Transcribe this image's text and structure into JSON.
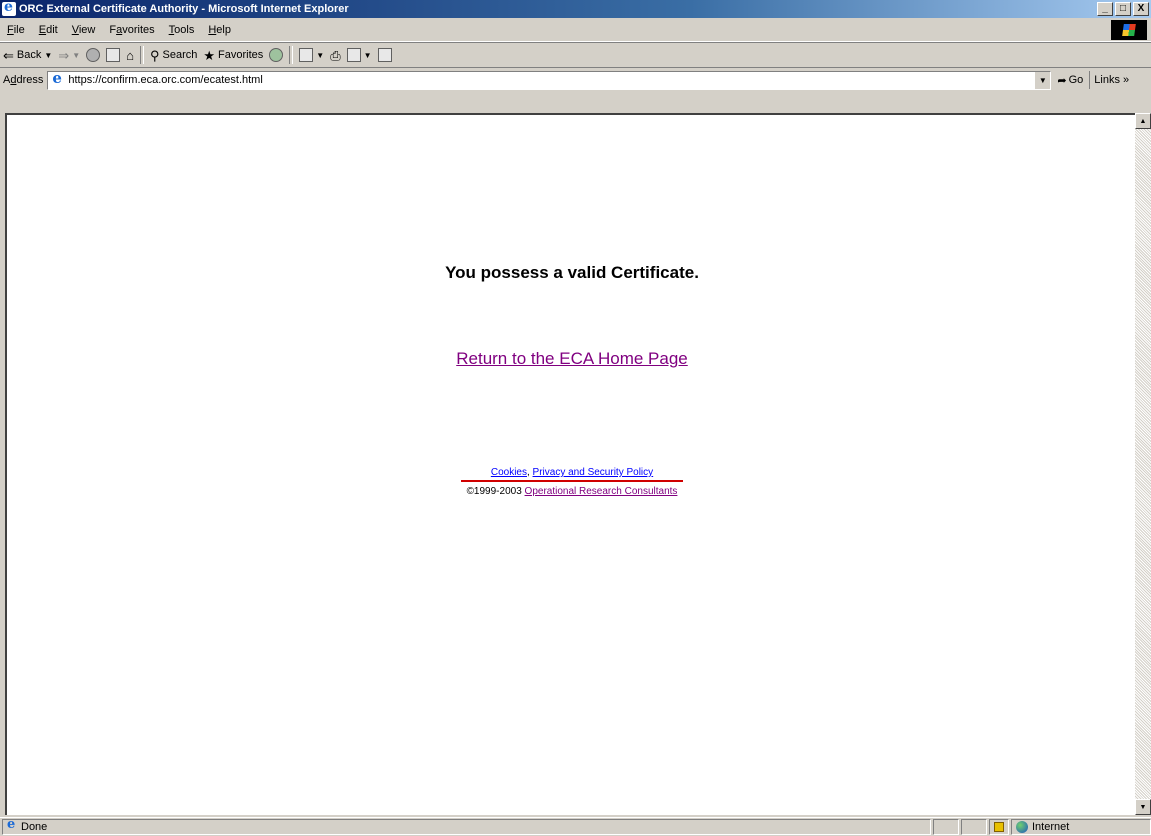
{
  "window": {
    "title": "ORC External Certificate Authority - Microsoft Internet Explorer",
    "controls": [
      "_",
      "□",
      "X"
    ]
  },
  "menu": {
    "items": [
      {
        "label_u": "F",
        "label_rest": "ile"
      },
      {
        "label_u": "E",
        "label_rest": "dit"
      },
      {
        "label_u": "V",
        "label_rest": "iew"
      },
      {
        "label_pre": "F",
        "label_u": "a",
        "label_rest": "vorites"
      },
      {
        "label_u": "T",
        "label_rest": "ools"
      },
      {
        "label_u": "H",
        "label_rest": "elp"
      }
    ]
  },
  "toolbar": {
    "back_label": "Back",
    "search_label": "Search",
    "favorites_label": "Favorites"
  },
  "address": {
    "label_pre": "A",
    "label_u": "d",
    "label_rest": "dress",
    "url": "https://confirm.eca.orc.com/ecatest.html",
    "go_label": "Go",
    "links_label": "Links »"
  },
  "page": {
    "headline": "You possess a valid Certificate.",
    "home_link": "Return to the ECA Home Page",
    "cookies_link": "Cookies",
    "separator": ",",
    "privacy_link": "Privacy and Security Policy",
    "copyright_prefix": "©1999-2003",
    "company_link": "Operational Research Consultants"
  },
  "status": {
    "text": "Done",
    "zone": "Internet"
  },
  "colors": {
    "title_gradient_start": "#0a246a",
    "visited_link": "#800080",
    "link": "#0000ff",
    "underline_annotation": "#d00000"
  }
}
